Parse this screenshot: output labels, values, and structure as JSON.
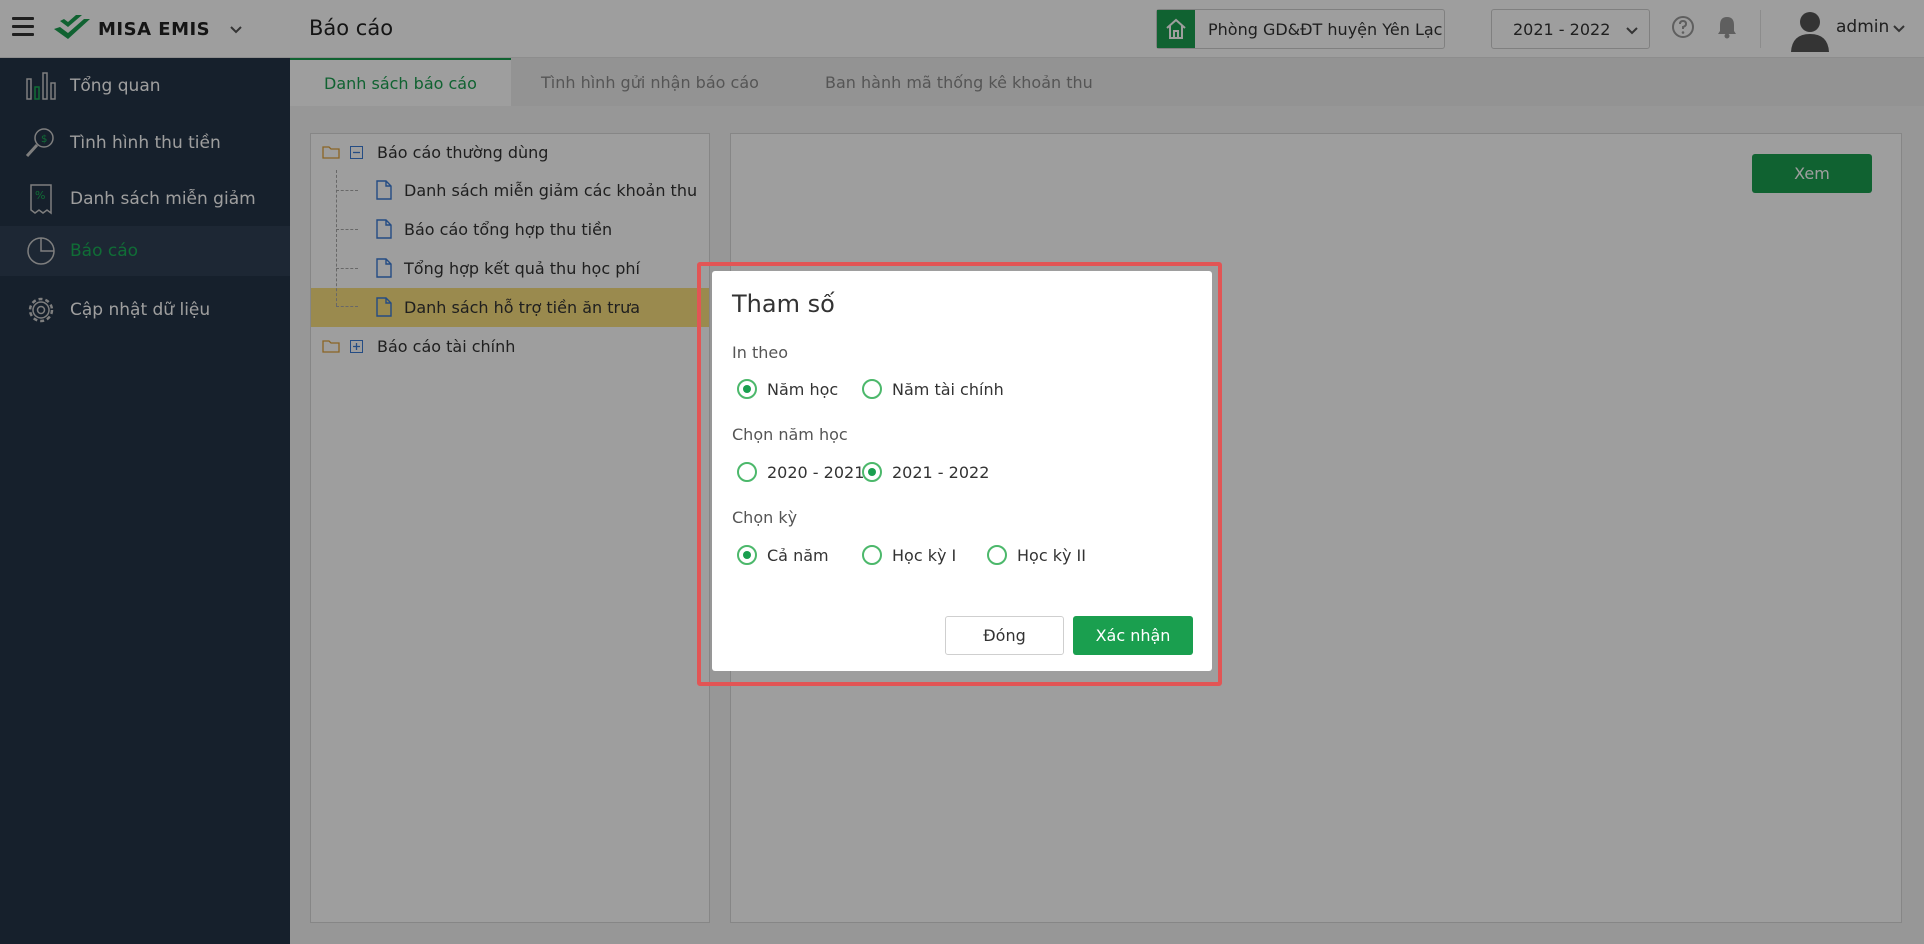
{
  "app": {
    "name": "MISA EMIS"
  },
  "header": {
    "page_title": "Báo cáo",
    "unit": "Phòng GD&ĐT huyện Yên Lạc",
    "school_year": "2021 - 2022",
    "user": "admin"
  },
  "sidebar": {
    "items": [
      {
        "label": "Tổng quan",
        "icon": "chart-bars-icon"
      },
      {
        "label": "Tình hình thu tiền",
        "icon": "magnifier-coin-icon"
      },
      {
        "label": "Danh sách miễn giảm",
        "icon": "percent-receipt-icon"
      },
      {
        "label": "Báo cáo",
        "icon": "pie-chart-icon",
        "active": true
      },
      {
        "label": "Cập nhật dữ liệu",
        "icon": "gear-icon"
      }
    ]
  },
  "tabs": [
    {
      "label": "Danh sách báo cáo",
      "active": true
    },
    {
      "label": "Tình hình gửi nhận báo cáo"
    },
    {
      "label": "Ban hành mã thống kê khoản thu"
    }
  ],
  "tree": {
    "group1": "Báo cáo thường dùng",
    "group1_children": [
      "Danh sách miễn giảm các khoản thu",
      "Báo cáo tổng hợp thu tiền",
      "Tổng hợp kết quả thu học phí",
      "Danh sách hỗ trợ tiền ăn trưa"
    ],
    "group2": "Báo cáo tài chính"
  },
  "view_button": "Xem",
  "dialog": {
    "title": "Tham số",
    "print_by": {
      "label": "In theo",
      "options": [
        "Năm học",
        "Năm tài chính"
      ],
      "selected": "Năm học"
    },
    "school_year": {
      "label": "Chọn năm học",
      "options": [
        "2020 - 2021",
        "2021 - 2022"
      ],
      "selected": "2021 - 2022"
    },
    "period": {
      "label": "Chọn kỳ",
      "options": [
        "Cả năm",
        "Học kỳ I",
        "Học kỳ II"
      ],
      "selected": "Cả năm"
    },
    "close_button": "Đóng",
    "confirm_button": "Xác nhận"
  },
  "colors": {
    "brand_green": "#1a9f4f",
    "sidebar_bg": "#243447",
    "highlight_frame": "#e25555",
    "tree_highlight": "#f9df7e"
  }
}
